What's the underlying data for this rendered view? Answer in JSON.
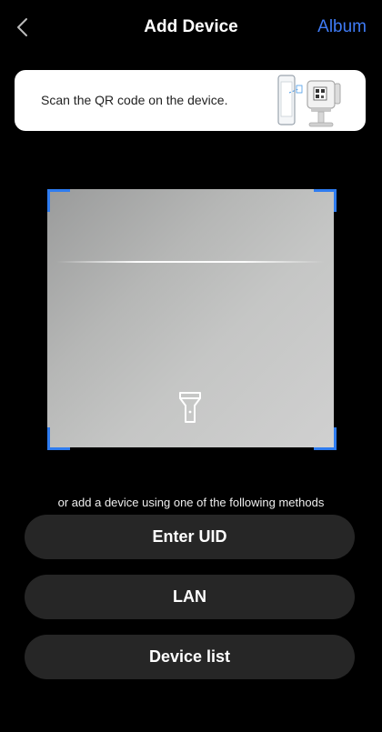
{
  "header": {
    "back_icon": "chevron-left-icon",
    "title": "Add Device",
    "album_label": "Album"
  },
  "info_card": {
    "text": "Scan the QR code on the device.",
    "illustration_icon": "phone-scanning-camera-qr-illustration"
  },
  "scanner": {
    "flashlight_icon": "flashlight-icon",
    "corner_color": "#2e7cf0"
  },
  "methods": {
    "caption": "or add a device using one of the following methods",
    "buttons": [
      {
        "label": "Enter UID"
      },
      {
        "label": "LAN"
      },
      {
        "label": "Device list"
      }
    ]
  },
  "colors": {
    "accent": "#3f7bf5",
    "background": "#000000",
    "button_bg": "#262626"
  }
}
